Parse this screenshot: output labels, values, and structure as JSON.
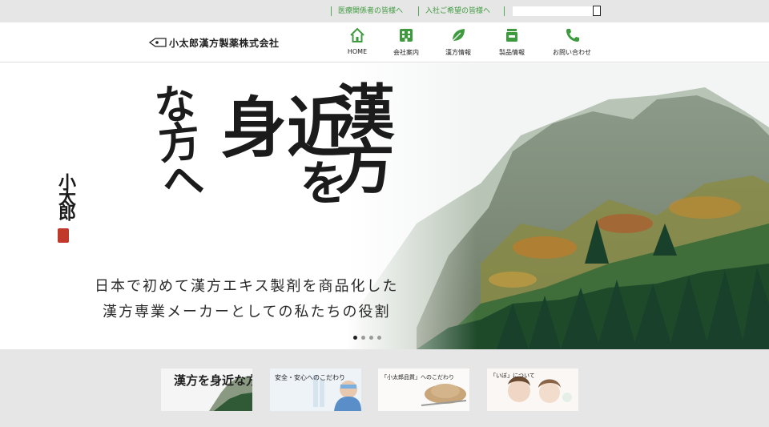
{
  "topbar": {
    "links": [
      {
        "label": "医療関係者の皆様へ"
      },
      {
        "label": "入社ご希望の皆様へ"
      }
    ],
    "search": {
      "placeholder": ""
    }
  },
  "header": {
    "logo_text": "小太郎漢方製薬株式会社",
    "nav": [
      {
        "label": "HOME",
        "icon": "home-icon"
      },
      {
        "label": "会社案内",
        "icon": "building-icon"
      },
      {
        "label": "漢方情報",
        "icon": "leaf-icon"
      },
      {
        "label": "製品情報",
        "icon": "product-icon"
      },
      {
        "label": "お問い合わせ",
        "icon": "phone-icon"
      }
    ],
    "accent_color": "#3d9a3d"
  },
  "hero": {
    "calligraphy": [
      "漢方",
      "を",
      "身近",
      "な方へ"
    ],
    "signature": "小太郎",
    "tagline_1": "日本で初めて漢方エキス製剤を商品化した",
    "tagline_2": "漢方専業メーカーとしての私たちの役割",
    "slide_count": 4,
    "active_slide": 1
  },
  "thumbnails": [
    {
      "label": "漢方を身近な方へ"
    },
    {
      "label": "安全・安心へのこだわり"
    },
    {
      "label": "「小太郎品質」へのこだわり"
    },
    {
      "label": "「いぼ」について"
    }
  ]
}
